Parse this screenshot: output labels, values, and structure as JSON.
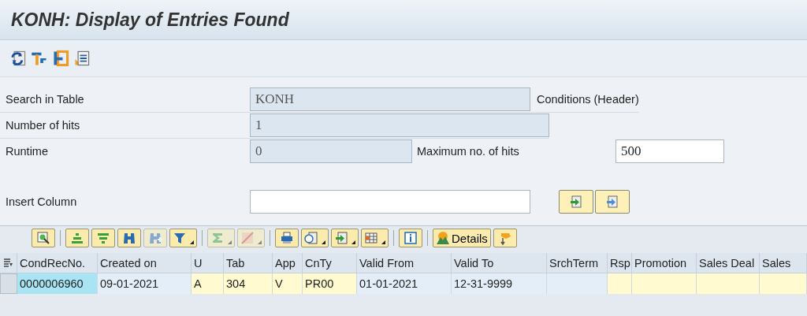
{
  "window": {
    "title": "KONH: Display of Entries Found"
  },
  "app_toolbar": [
    {
      "kind": "refresh"
    },
    {
      "kind": "tools"
    },
    {
      "kind": "bracket"
    },
    {
      "kind": "list"
    }
  ],
  "form": [
    {
      "label": "Search in Table",
      "value": "KONH",
      "kind": "display",
      "description": "Conditions (Header)"
    },
    {
      "label": "Number of hits",
      "value": "1",
      "kind": "display"
    },
    {
      "label": "Runtime",
      "value": "0",
      "kind": "display",
      "extra_label": "Maximum no. of hits",
      "extra_value": "500"
    }
  ],
  "insert_column": {
    "label": "Insert Column",
    "buttons": [
      {
        "kind": "insert"
      },
      {
        "kind": "export"
      }
    ]
  },
  "table_toolbar": [
    {
      "kind": "zoom",
      "disabled": false,
      "menu": false
    },
    {
      "kind": "sep"
    },
    {
      "kind": "sort-up",
      "disabled": false,
      "menu": false
    },
    {
      "kind": "sort-down",
      "disabled": false,
      "menu": false
    },
    {
      "kind": "find",
      "disabled": false,
      "menu": false
    },
    {
      "kind": "find-next",
      "disabled": true,
      "menu": false
    },
    {
      "kind": "filter",
      "disabled": false,
      "menu": true
    },
    {
      "kind": "sep"
    },
    {
      "kind": "sum",
      "disabled": true,
      "menu": true
    },
    {
      "kind": "subtotal",
      "disabled": true,
      "menu": true
    },
    {
      "kind": "sep"
    },
    {
      "kind": "print",
      "disabled": false,
      "menu": false
    },
    {
      "kind": "view",
      "disabled": false,
      "menu": true
    },
    {
      "kind": "export",
      "disabled": false,
      "menu": true
    },
    {
      "kind": "layout",
      "disabled": false,
      "menu": true
    },
    {
      "kind": "sep"
    },
    {
      "kind": "info",
      "disabled": false,
      "menu": false
    },
    {
      "kind": "sep"
    },
    {
      "kind": "details",
      "label": "Details",
      "disabled": false,
      "menu": false
    },
    {
      "kind": "graphic",
      "disabled": false,
      "menu": false
    }
  ],
  "table": {
    "columns": [
      {
        "title": "CondRecNo.",
        "kind": "key"
      },
      {
        "title": "Created on",
        "kind": "plain"
      },
      {
        "title": "U",
        "kind": "field"
      },
      {
        "title": "Tab",
        "kind": "field"
      },
      {
        "title": "App",
        "kind": "field"
      },
      {
        "title": "CnTy",
        "kind": "field"
      },
      {
        "title": "Valid From",
        "kind": "plain"
      },
      {
        "title": "Valid To",
        "kind": "plain"
      },
      {
        "title": "SrchTerm",
        "kind": "plain"
      },
      {
        "title": "Rsp",
        "kind": "field"
      },
      {
        "title": "Promotion",
        "kind": "field"
      },
      {
        "title": "Sales Deal",
        "kind": "field"
      },
      {
        "title": "Sales",
        "kind": "field"
      }
    ],
    "rows": [
      {
        "cells": [
          "0000006960",
          "09-01-2021",
          "A",
          "304",
          "V",
          "PR00",
          "01-01-2021",
          "12-31-9999",
          "",
          "",
          "",
          "",
          ""
        ]
      }
    ]
  }
}
